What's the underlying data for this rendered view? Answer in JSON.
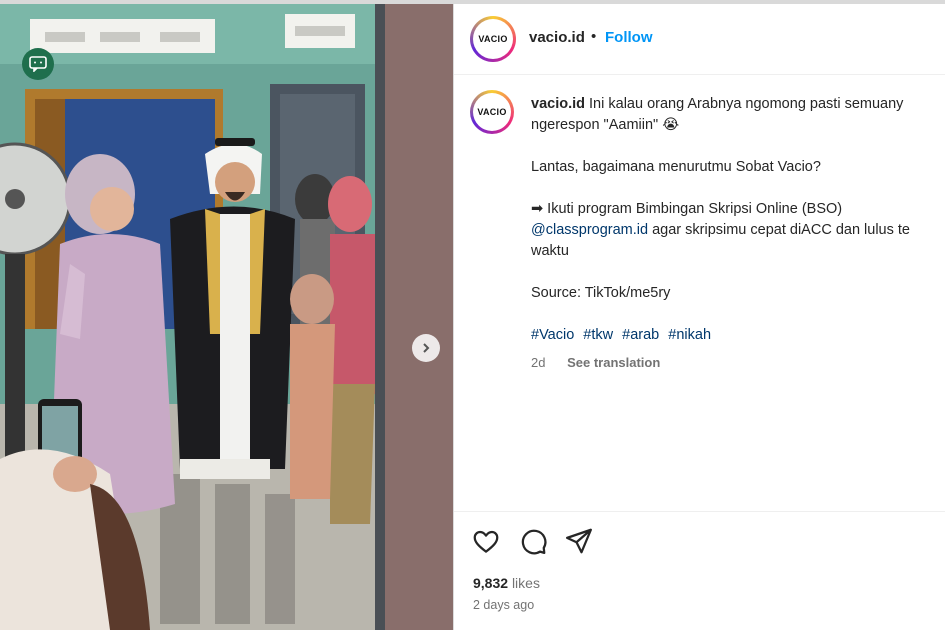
{
  "post": {
    "username": "vacio.id",
    "avatar_logo": "VACIO",
    "follow_label": "Follow",
    "separator": "•",
    "caption_line1": "Ini kalau orang Arabnya ngomong pasti semuany",
    "caption_line2": "ngerespon \"Aamiin\" 😭",
    "caption_para2": "Lantas, bagaimana menurutmu Sobat Vacio?",
    "caption_para3": "➡ Ikuti program Bimbingan Skripsi Online (BSO)",
    "mention": "@classprogram.id",
    "caption_para3b": " agar skripsimu cepat diACC dan lulus te",
    "caption_para3c": "waktu",
    "source": "Source: TikTok/me5ry",
    "hashtags": [
      "#Vacio",
      "#tkw",
      "#arab",
      "#nikah"
    ],
    "age_short": "2d",
    "see_translation": "See translation",
    "likes_count": "9,832",
    "likes_word": "likes",
    "posted_ago": "2 days ago"
  },
  "icons": {
    "like": "heart-icon",
    "comment": "comment-icon",
    "share": "send-icon",
    "next": "chevron-right-icon",
    "media_badge": "speech-bubble-icon"
  },
  "colors": {
    "follow": "#0095f6",
    "link": "#00376b",
    "muted": "#737373"
  }
}
